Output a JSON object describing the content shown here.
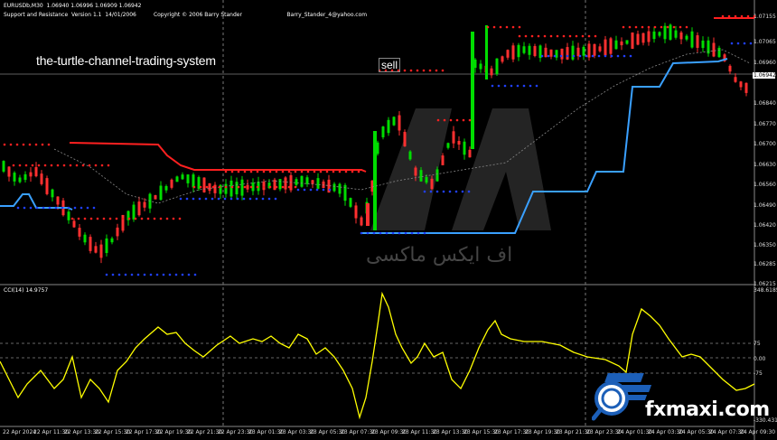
{
  "header": {
    "symbol_line": "EURUSDb,M30  1.06940 1.06996 1.06909 1.06942",
    "indicator_line": "Support and Resistance  Version 1.1  14/01/2006          Copyright © 2006 Barry Stander                          Barry_Stander_4@yahoo.com"
  },
  "overlay": {
    "title": "the-turtle-channel-trading-system",
    "sell_label": "sell"
  },
  "price_axis": {
    "current_price": "1.06942",
    "ticks": [
      "1.07155",
      "1.07065",
      "1.06960",
      "1.06910",
      "1.06840",
      "1.06770",
      "1.06700",
      "1.06630",
      "1.06560",
      "1.06490",
      "1.06420",
      "1.06350",
      "1.06285",
      "1.06215"
    ]
  },
  "cci": {
    "label": "CCI(14) 14.9757",
    "ticks": [
      "348.6185",
      "75",
      "0.00",
      "-75",
      "-330.4319"
    ]
  },
  "time_axis": {
    "ticks": [
      "22 Apr 2024",
      "22 Apr 11:30",
      "22 Apr 13:30",
      "22 Apr 15:30",
      "22 Apr 17:30",
      "22 Apr 19:30",
      "22 Apr 21:30",
      "22 Apr 23:30",
      "23 Apr 01:30",
      "23 Apr 03:30",
      "23 Apr 05:30",
      "23 Apr 07:30",
      "23 Apr 09:30",
      "23 Apr 11:30",
      "23 Apr 13:30",
      "23 Apr 15:30",
      "23 Apr 17:30",
      "23 Apr 19:30",
      "23 Apr 21:30",
      "23 Apr 23:30",
      "24 Apr 01:30",
      "24 Apr 03:30",
      "24 Apr 05:30",
      "24 Apr 07:30",
      "24 Apr 09:30"
    ]
  },
  "watermark": {
    "arabic_text": "اف ایکس ماکسی"
  },
  "brand": {
    "name": "fxmaxi.com"
  },
  "colors": {
    "bull": "#00dd00",
    "bear": "#ff3030",
    "channel_red": "#ff2020",
    "channel_blue": "#3aa0ff",
    "cci": "#ffff00",
    "dots_red": "#ff2020",
    "dots_blue": "#2040ff"
  }
}
